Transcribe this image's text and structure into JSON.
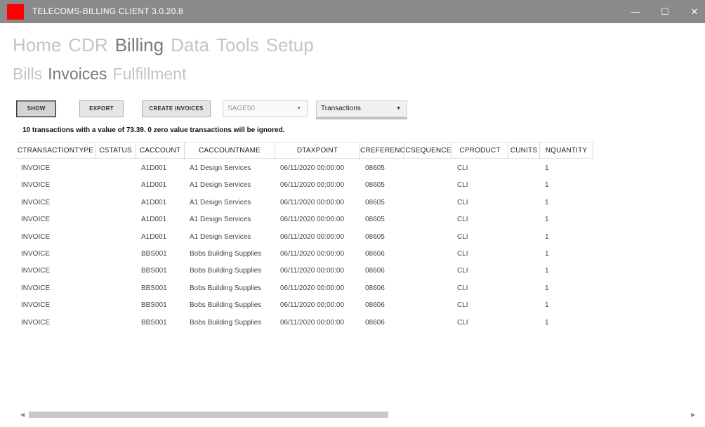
{
  "window": {
    "title": "TELECOMS-BILLING CLIENT 3.0.20.8",
    "minimize_glyph": "—",
    "maximize_glyph": "☐",
    "close_glyph": "✕",
    "icon_color": "#ff0000"
  },
  "main_nav": {
    "items": [
      {
        "label": "Home",
        "active": false
      },
      {
        "label": "CDR",
        "active": false
      },
      {
        "label": "Billing",
        "active": true
      },
      {
        "label": "Data",
        "active": false
      },
      {
        "label": "Tools",
        "active": false
      },
      {
        "label": "Setup",
        "active": false
      }
    ]
  },
  "sub_nav": {
    "items": [
      {
        "label": "Bills",
        "active": false
      },
      {
        "label": "Invoices",
        "active": true
      },
      {
        "label": "Fulfillment",
        "active": false
      }
    ]
  },
  "toolbar": {
    "show_label": "SHOW",
    "export_label": "EXPORT",
    "create_invoices_label": "CREATE INVOICES",
    "sage_select_value": "SAGE50",
    "type_select_value": "Transactions",
    "dropdown_arrow": "▼"
  },
  "summary": "10 transactions with a value of 73.39. 0 zero value transactions will be ignored.",
  "grid": {
    "columns": [
      "CTRANSACTIONTYPE",
      "CSTATUS",
      "CACCOUNT",
      "CACCOUNTNAME",
      "DTAXPOINT",
      "CREFERENCE",
      "CSEQUENCE",
      "CPRODUCT",
      "CUNITS",
      "NQUANTITY"
    ],
    "rows": [
      [
        "INVOICE",
        "",
        "A1D001",
        "A1 Design Services",
        "06/11/2020 00:00:00",
        "08605",
        "",
        "CLI",
        "",
        "1"
      ],
      [
        "INVOICE",
        "",
        "A1D001",
        "A1 Design Services",
        "06/11/2020 00:00:00",
        "08605",
        "",
        "CLI",
        "",
        "1"
      ],
      [
        "INVOICE",
        "",
        "A1D001",
        "A1 Design Services",
        "06/11/2020 00:00:00",
        "08605",
        "",
        "CLI",
        "",
        "1"
      ],
      [
        "INVOICE",
        "",
        "A1D001",
        "A1 Design Services",
        "06/11/2020 00:00:00",
        "08605",
        "",
        "CLI",
        "",
        "1"
      ],
      [
        "INVOICE",
        "",
        "A1D001",
        "A1 Design Services",
        "06/11/2020 00:00:00",
        "08605",
        "",
        "CLI",
        "",
        "1"
      ],
      [
        "INVOICE",
        "",
        "BBS001",
        "Bobs Building Supplies",
        "06/11/2020 00:00:00",
        "08606",
        "",
        "CLI",
        "",
        "1"
      ],
      [
        "INVOICE",
        "",
        "BBS001",
        "Bobs Building Supplies",
        "06/11/2020 00:00:00",
        "08606",
        "",
        "CLI",
        "",
        "1"
      ],
      [
        "INVOICE",
        "",
        "BBS001",
        "Bobs Building Supplies",
        "06/11/2020 00:00:00",
        "08606",
        "",
        "CLI",
        "",
        "1"
      ],
      [
        "INVOICE",
        "",
        "BBS001",
        "Bobs Building Supplies",
        "06/11/2020 00:00:00",
        "08606",
        "",
        "CLI",
        "",
        "1"
      ],
      [
        "INVOICE",
        "",
        "BBS001",
        "Bobs Building Supplies",
        "06/11/2020 00:00:00",
        "08606",
        "",
        "CLI",
        "",
        "1"
      ]
    ]
  },
  "scrollbar": {
    "left_arrow": "◀",
    "right_arrow": "▶"
  }
}
